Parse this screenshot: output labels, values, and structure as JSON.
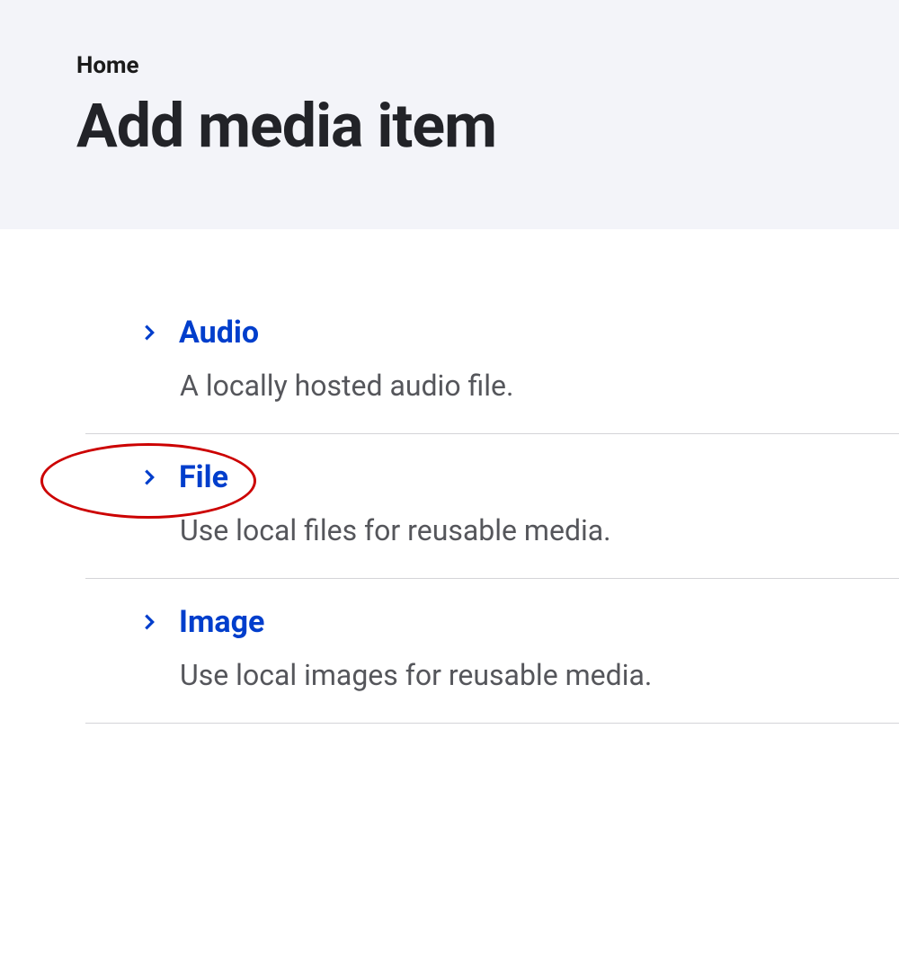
{
  "breadcrumb": "Home",
  "page_title": "Add media item",
  "media_items": [
    {
      "title": "Audio",
      "description": "A locally hosted audio file."
    },
    {
      "title": "File",
      "description": "Use local files for reusable media."
    },
    {
      "title": "Image",
      "description": "Use local images for reusable media."
    }
  ],
  "highlighted_item_index": 1
}
